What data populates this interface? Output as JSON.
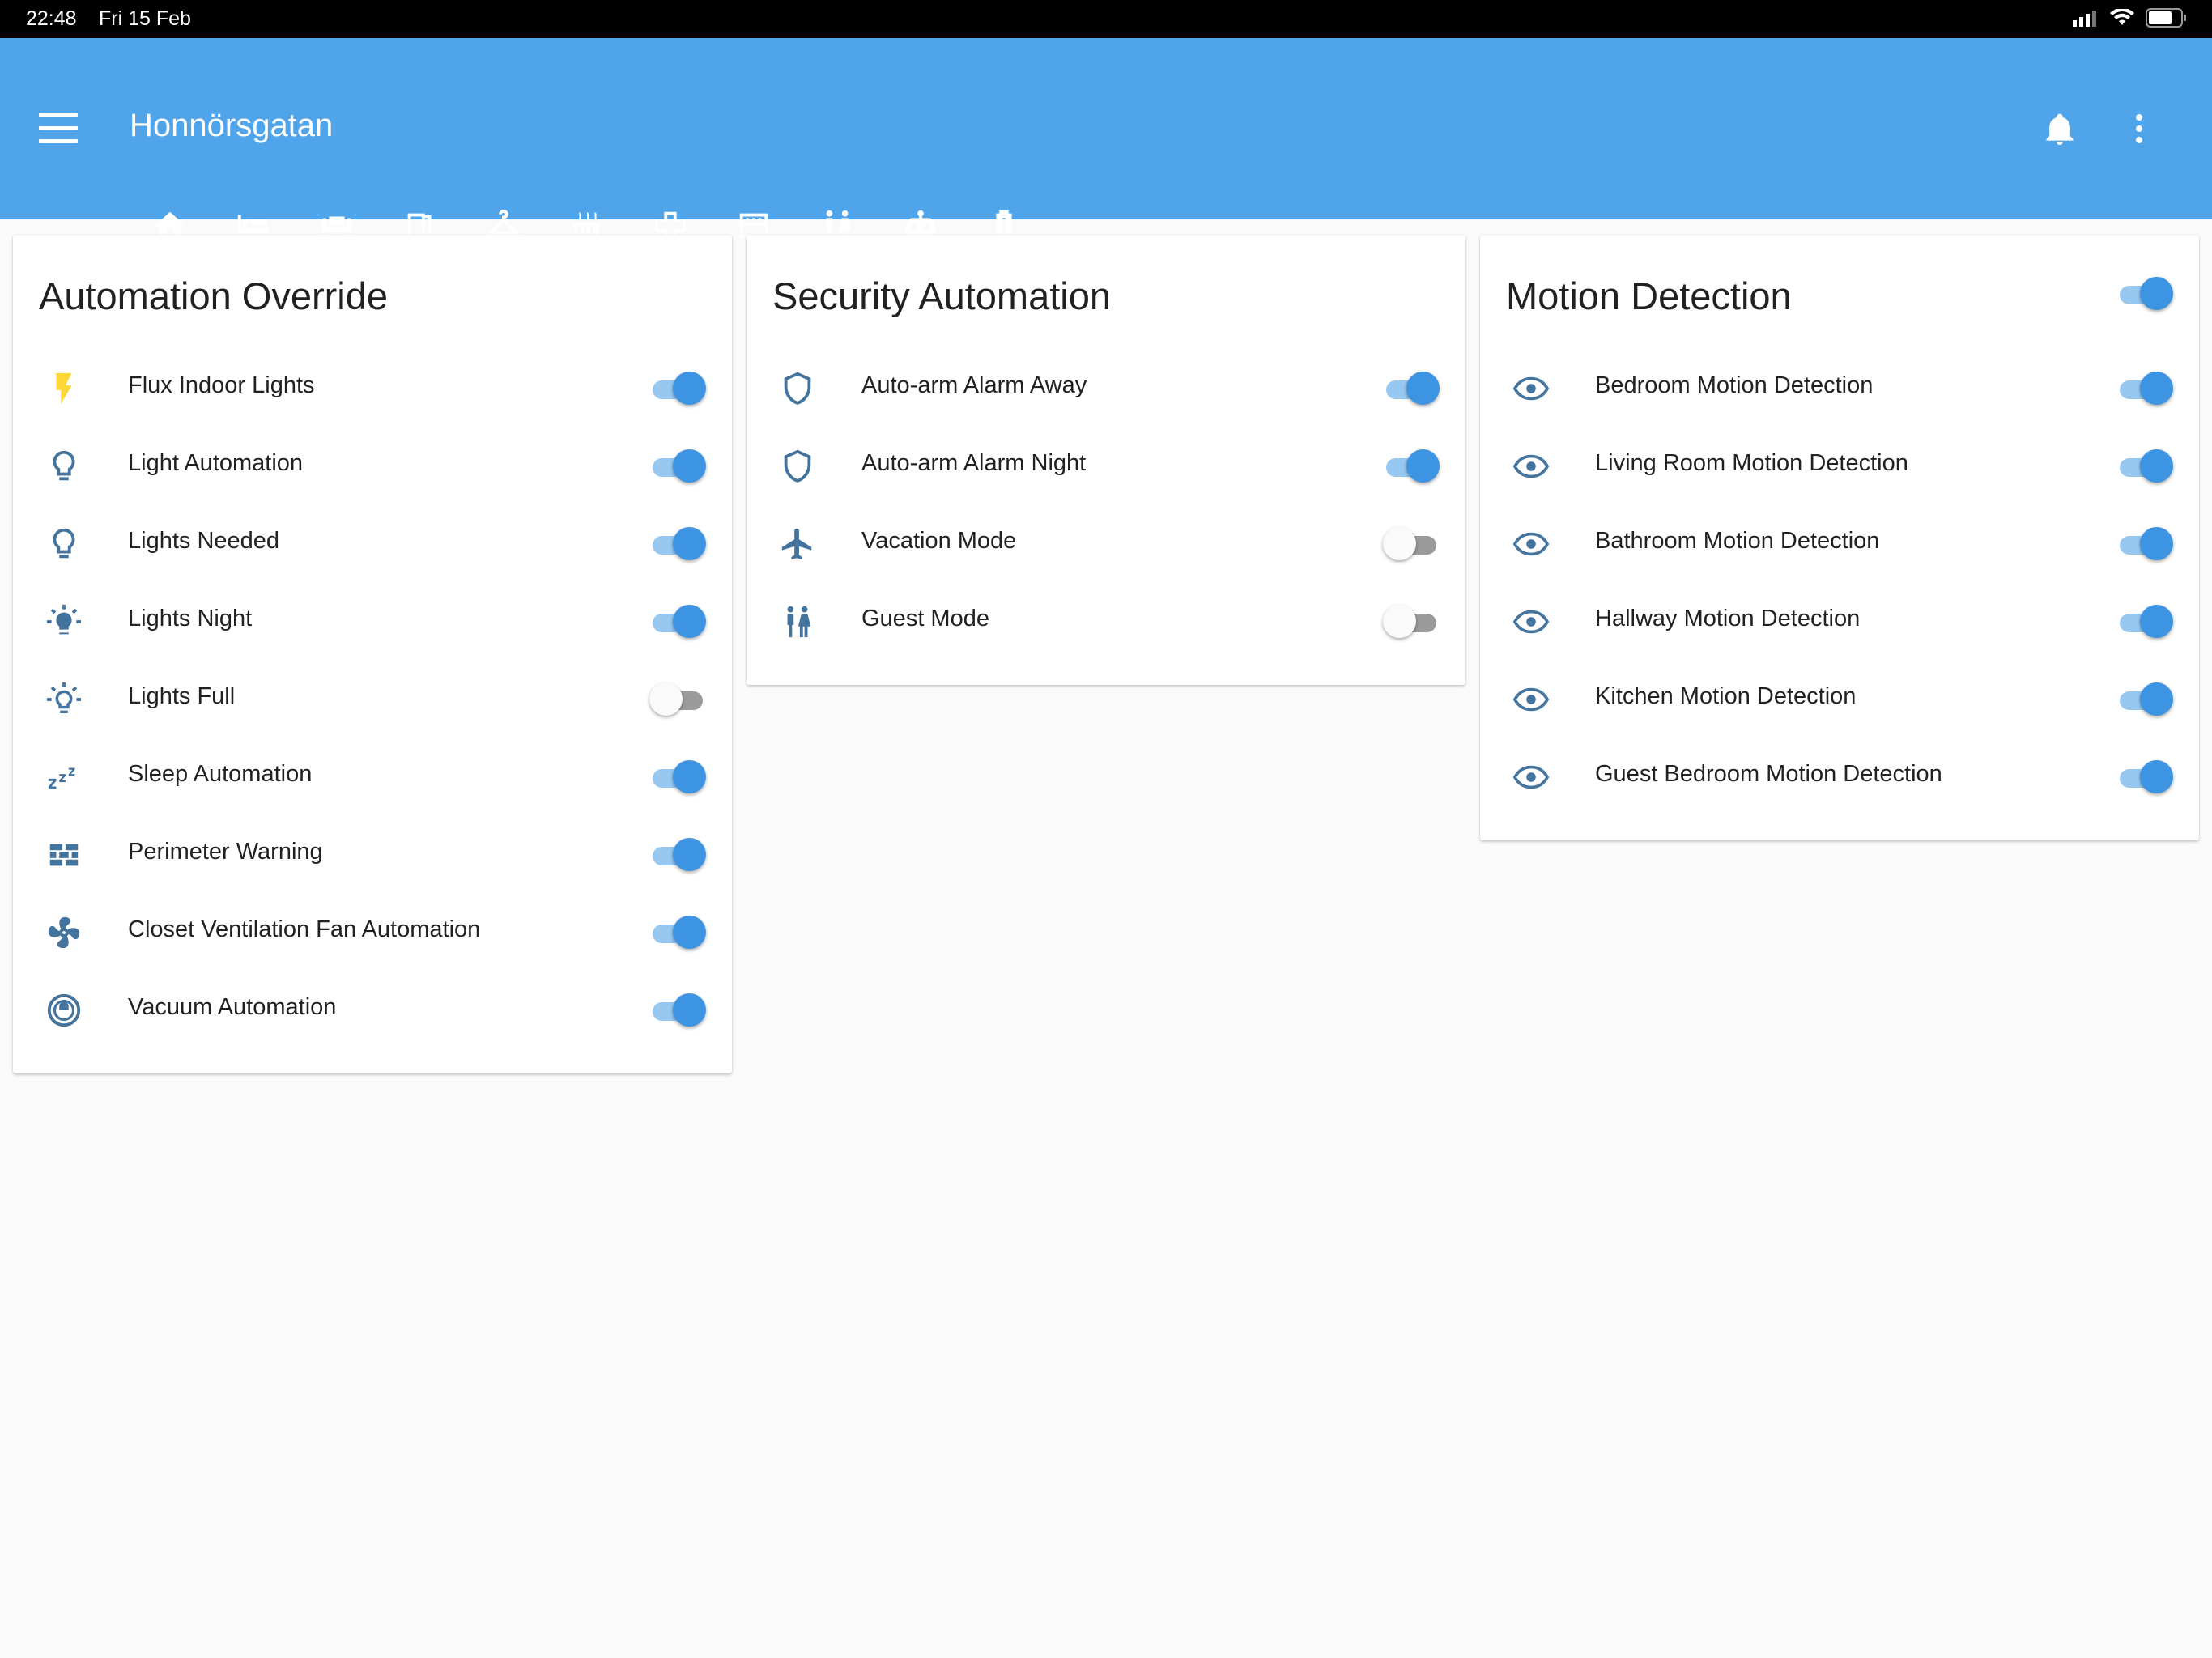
{
  "status_bar": {
    "time": "22:48",
    "date": "Fri 15 Feb"
  },
  "header": {
    "title": "Honnörsgatan"
  },
  "colors": {
    "header": "#4fa4ea",
    "toggle_on": "#3d94e2",
    "toggle_on_track": "#97c8f1",
    "icon": "#44739e",
    "flux_icon": "#fdd835"
  },
  "tabs": [
    {
      "icon": "home-icon",
      "active": false
    },
    {
      "icon": "bed-icon",
      "active": false
    },
    {
      "icon": "sofa-icon",
      "active": false
    },
    {
      "icon": "door-icon",
      "active": false
    },
    {
      "icon": "hanger-icon",
      "active": false
    },
    {
      "icon": "stove-icon",
      "active": false
    },
    {
      "icon": "hallway-icon",
      "active": false
    },
    {
      "icon": "kitchen-icon",
      "active": false
    },
    {
      "icon": "guest-icon",
      "active": false
    },
    {
      "icon": "robot-icon",
      "active": true
    },
    {
      "icon": "battery-alert-icon",
      "active": false
    }
  ],
  "cards": {
    "automation_override": {
      "title": "Automation Override",
      "rows": [
        {
          "label": "Flux Indoor Lights",
          "icon": "flash-icon",
          "on": true
        },
        {
          "label": "Light Automation",
          "icon": "lightbulb-outline-icon",
          "on": true
        },
        {
          "label": "Lights Needed",
          "icon": "lightbulb-outline-icon",
          "on": true
        },
        {
          "label": "Lights Night",
          "icon": "lightbulb-on-icon",
          "on": true
        },
        {
          "label": "Lights Full",
          "icon": "lightbulb-on-outline-icon",
          "on": false
        },
        {
          "label": "Sleep Automation",
          "icon": "sleep-icon",
          "on": true
        },
        {
          "label": "Perimeter Warning",
          "icon": "wall-icon",
          "on": true
        },
        {
          "label": "Closet Ventilation Fan Automation",
          "icon": "fan-icon",
          "on": true
        },
        {
          "label": "Vacuum Automation",
          "icon": "robot-vacuum-icon",
          "on": true
        }
      ]
    },
    "security_automation": {
      "title": "Security Automation",
      "rows": [
        {
          "label": "Auto-arm Alarm Away",
          "icon": "shield-outline-icon",
          "on": true
        },
        {
          "label": "Auto-arm Alarm Night",
          "icon": "shield-outline-icon",
          "on": true
        },
        {
          "label": "Vacation Mode",
          "icon": "airplane-icon",
          "on": false
        },
        {
          "label": "Guest Mode",
          "icon": "human-male-female-icon",
          "on": false
        }
      ]
    },
    "motion_detection": {
      "title": "Motion Detection",
      "header_on": true,
      "rows": [
        {
          "label": "Bedroom Motion Detection",
          "icon": "eye-icon",
          "on": true
        },
        {
          "label": "Living Room Motion Detection",
          "icon": "eye-icon",
          "on": true
        },
        {
          "label": "Bathroom Motion Detection",
          "icon": "eye-icon",
          "on": true
        },
        {
          "label": "Hallway Motion Detection",
          "icon": "eye-icon",
          "on": true
        },
        {
          "label": "Kitchen Motion Detection",
          "icon": "eye-icon",
          "on": true
        },
        {
          "label": "Guest Bedroom Motion Detection",
          "icon": "eye-icon",
          "on": true
        }
      ]
    }
  }
}
